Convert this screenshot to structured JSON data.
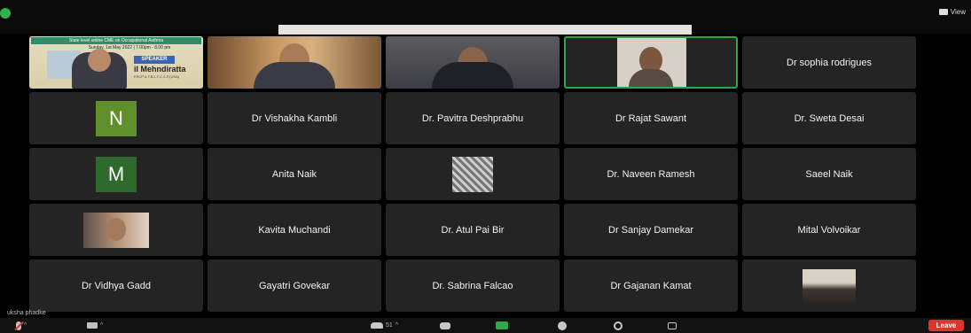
{
  "topbar": {
    "view_label": "View"
  },
  "poster": {
    "banner": "State level online CME on Occupational Asthma",
    "date": "Sunday, 1st May 2022 | 7.00pm - 8.00 pm",
    "speaker_tag": "SPEAKER",
    "speaker_name": "il Mehndiratta",
    "speaker_sub": "FRCP & T.B.L.F.C.C.P.(USA)"
  },
  "participants": {
    "r1c5": "Dr sophia rodrigues",
    "r2c1_initial": "N",
    "r2c2": "Dr Vishakha Kambli",
    "r2c3": "Dr. Pavitra Deshprabhu",
    "r2c4": "Dr Rajat Sawant",
    "r2c5": "Dr. Sweta Desai",
    "r3c1_initial": "M",
    "r3c2": "Anita Naik",
    "r3c4": "Dr. Naveen Ramesh",
    "r3c5": "Saeel Naik",
    "r4c2": "Kavita Muchandi",
    "r4c3": "Dr. Atul Pai Bir",
    "r4c4": "Dr Sanjay Damekar",
    "r4c5": "Mital Volvoikar",
    "r5c1": "Dr Vidhya Gadd",
    "r5c2": "Gayatri Govekar",
    "r5c3": "Dr. Sabrina Falcao",
    "r5c4": "Dr Gajanan Kamat"
  },
  "self_name": "uksha phadke",
  "toolbar": {
    "participants_count": "51",
    "leave_label": "Leave"
  },
  "colors": {
    "active_speaker": "#2fa54a",
    "leave": "#d9372d",
    "avatar_n": "#5f8f2a",
    "avatar_m": "#2e6a2c"
  }
}
